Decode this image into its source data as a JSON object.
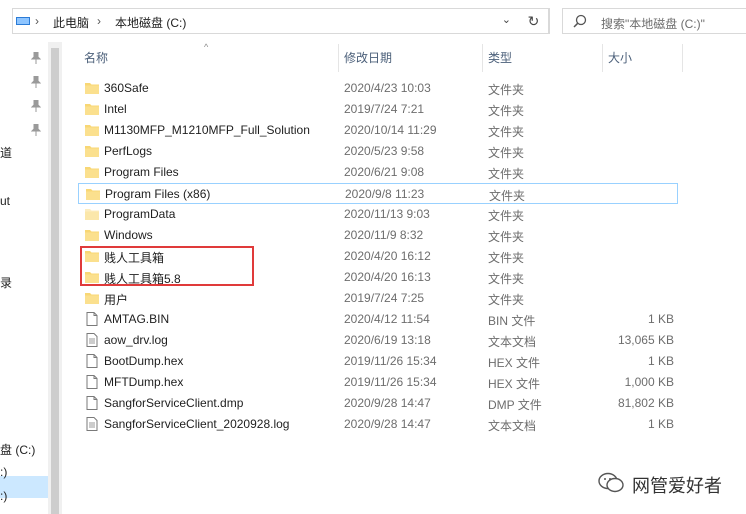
{
  "address": {
    "crumbs": [
      "此电脑",
      "本地磁盘 (C:)"
    ],
    "search_placeholder": "搜索\"本地磁盘 (C:)\""
  },
  "nav": {
    "fragments": [
      "道",
      "ut",
      "录",
      "盘 (C:)",
      ":)",
      ":)"
    ]
  },
  "columns": {
    "name": "名称",
    "modified": "修改日期",
    "type": "类型",
    "size": "大小"
  },
  "files": [
    {
      "name": "360Safe",
      "date": "2020/4/23 10:03",
      "type": "文件夹",
      "size": "",
      "icon": "folder-icon"
    },
    {
      "name": "Intel",
      "date": "2019/7/24 7:21",
      "type": "文件夹",
      "size": "",
      "icon": "folder-icon"
    },
    {
      "name": "M1130MFP_M1210MFP_Full_Solution",
      "date": "2020/10/14 11:29",
      "type": "文件夹",
      "size": "",
      "icon": "folder-icon"
    },
    {
      "name": "PerfLogs",
      "date": "2020/5/23 9:58",
      "type": "文件夹",
      "size": "",
      "icon": "folder-icon"
    },
    {
      "name": "Program Files",
      "date": "2020/6/21 9:08",
      "type": "文件夹",
      "size": "",
      "icon": "folder-icon"
    },
    {
      "name": "Program Files (x86)",
      "date": "2020/9/8 11:23",
      "type": "文件夹",
      "size": "",
      "icon": "folder-icon"
    },
    {
      "name": "ProgramData",
      "date": "2020/11/13 9:03",
      "type": "文件夹",
      "size": "",
      "icon": "hidden-folder-icon"
    },
    {
      "name": "Windows",
      "date": "2020/11/9 8:32",
      "type": "文件夹",
      "size": "",
      "icon": "folder-icon"
    },
    {
      "name": "贱人工具箱",
      "date": "2020/4/20 16:12",
      "type": "文件夹",
      "size": "",
      "icon": "folder-icon"
    },
    {
      "name": "贱人工具箱5.8",
      "date": "2020/4/20 16:13",
      "type": "文件夹",
      "size": "",
      "icon": "folder-icon"
    },
    {
      "name": "用户",
      "date": "2019/7/24 7:25",
      "type": "文件夹",
      "size": "",
      "icon": "folder-icon"
    },
    {
      "name": "AMTAG.BIN",
      "date": "2020/4/12 11:54",
      "type": "BIN 文件",
      "size": "1 KB",
      "icon": "file-icon"
    },
    {
      "name": "aow_drv.log",
      "date": "2020/6/19 13:18",
      "type": "文本文档",
      "size": "13,065 KB",
      "icon": "text-file-icon"
    },
    {
      "name": "BootDump.hex",
      "date": "2019/11/26 15:34",
      "type": "HEX 文件",
      "size": "1 KB",
      "icon": "file-icon"
    },
    {
      "name": "MFTDump.hex",
      "date": "2019/11/26 15:34",
      "type": "HEX 文件",
      "size": "1,000 KB",
      "icon": "file-icon"
    },
    {
      "name": "SangforServiceClient.dmp",
      "date": "2020/9/28 14:47",
      "type": "DMP 文件",
      "size": "81,802 KB",
      "icon": "file-icon"
    },
    {
      "name": "SangforServiceClient_2020928.log",
      "date": "2020/9/28 14:47",
      "type": "文本文档",
      "size": "1 KB",
      "icon": "text-file-icon"
    }
  ],
  "highlighted_row": "Program Files (x86)",
  "watermark": "网管爱好者",
  "colors": {
    "folder": "#f8d775",
    "highlight_border": "#99d1ff",
    "annotation_box": "#e03a3a",
    "selection": "#cce8ff"
  }
}
